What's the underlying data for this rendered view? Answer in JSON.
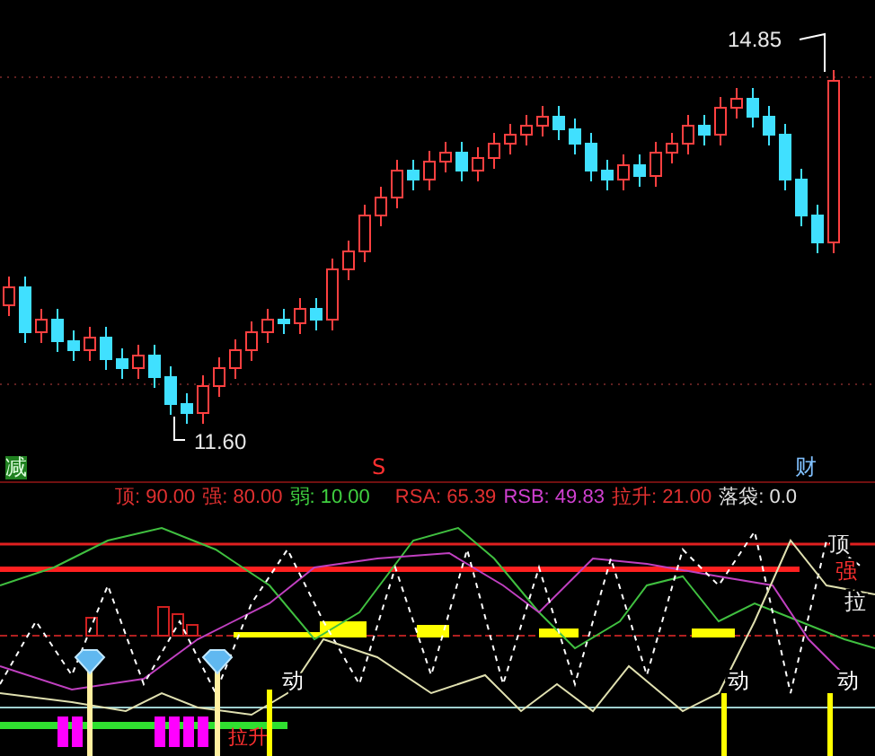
{
  "price_chart": {
    "high_label": "14.85",
    "low_label": "11.60"
  },
  "markers": [
    {
      "text": "减",
      "kind": "sell"
    },
    {
      "text": "S",
      "kind": "signal"
    },
    {
      "text": "财",
      "kind": "finance"
    }
  ],
  "legend": [
    {
      "label": "顶: 90.00",
      "color": "#e03030"
    },
    {
      "label": "强: 80.00",
      "color": "#e03030"
    },
    {
      "label": "弱: 10.00",
      "color": "#40d040"
    },
    {
      "label": "RSA: 65.39",
      "color": "#e03030"
    },
    {
      "label": "RSB: 49.83",
      "color": "#d040d0"
    },
    {
      "label": "拉升: 21.00",
      "color": "#e03030"
    },
    {
      "label": "落袋: 0.0",
      "color": "#e0e0e0"
    }
  ],
  "indicator": {
    "line_labels": [
      {
        "text": "顶",
        "color": "#e8e8e8"
      },
      {
        "text": "强",
        "color": "#ff3030"
      },
      {
        "text": "拉",
        "color": "#e8e8e8"
      }
    ],
    "rise_label": "拉升",
    "signals": [
      "动",
      "动",
      "动"
    ]
  }
}
